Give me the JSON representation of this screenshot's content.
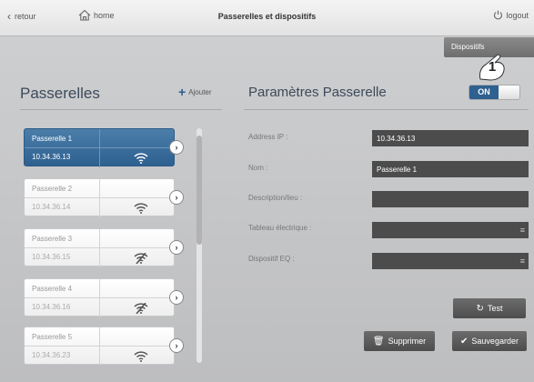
{
  "topbar": {
    "back_label": "retour",
    "home_label": "home",
    "title": "Passerelles et dispositifs",
    "logout_label": "logout"
  },
  "dispositifs_button": "Dispositifs",
  "left": {
    "title": "Passerelles",
    "add_label": "Ajouter",
    "items": [
      {
        "name": "Passerelle 1",
        "ip": "10.34.36.13",
        "selected": true,
        "signal": "wifi"
      },
      {
        "name": "Passerelle 2",
        "ip": "10.34.36.14",
        "selected": false,
        "signal": "wifi"
      },
      {
        "name": "Passerelle 3",
        "ip": "10.34.36.15",
        "selected": false,
        "signal": "wifi-off"
      },
      {
        "name": "Passerelle 4",
        "ip": "10.34.36.16",
        "selected": false,
        "signal": "wifi-off"
      },
      {
        "name": "Passerelle 5",
        "ip": "10.34.36.23",
        "selected": false,
        "signal": "wifi"
      }
    ]
  },
  "right": {
    "title": "Paramètres Passerelle",
    "toggle_label": "ON",
    "fields": [
      {
        "label": "Address IP :",
        "value": "10.34.36.13",
        "has_menu": false
      },
      {
        "label": "Nom :",
        "value": "Passerelle 1",
        "has_menu": false
      },
      {
        "label": "Description/lieu :",
        "value": "",
        "has_menu": false
      },
      {
        "label": "Tableau électrique :",
        "value": "",
        "has_menu": true
      },
      {
        "label": "Dispositif EQ :",
        "value": "",
        "has_menu": true
      }
    ],
    "test_label": "Test",
    "delete_label": "Supprimer",
    "save_label": "Sauvegarder"
  },
  "callout_number": "1",
  "colors": {
    "accent": "#2e6090",
    "field_bg": "#4c4c4c",
    "button_bg": "#5a5a5a"
  }
}
